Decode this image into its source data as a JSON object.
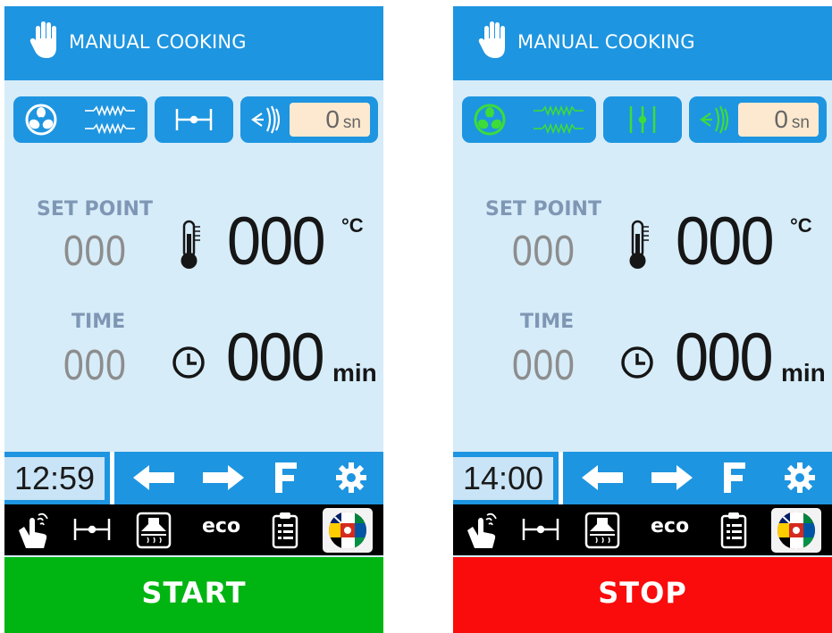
{
  "panels": [
    {
      "title": "MANUAL COOKING",
      "state": "idle",
      "accent_color": "#ffffff",
      "steam_value": "0",
      "steam_unit": "sn",
      "set_point_label": "SET POINT",
      "set_point_value": "000",
      "temperature_value": "000",
      "temperature_unit": "°C",
      "time_label": "TIME",
      "time_value": "000",
      "time_actual_value": "000",
      "time_unit": "min",
      "clock": "12:59",
      "eco_label": "eco",
      "action_label": "START",
      "action_color": "#00b512"
    },
    {
      "title": "MANUAL COOKING",
      "state": "running",
      "accent_color": "#3ddc3a",
      "steam_value": "0",
      "steam_unit": "sn",
      "set_point_label": "SET POINT",
      "set_point_value": "000",
      "temperature_value": "000",
      "temperature_unit": "°C",
      "time_label": "TIME",
      "time_value": "000",
      "time_actual_value": "000",
      "time_unit": "min",
      "clock": "14:00",
      "eco_label": "eco",
      "action_label": "STOP",
      "action_color": "#fa0c0c"
    }
  ],
  "icons": [
    "hand-icon",
    "fan-icon",
    "heater-icon",
    "damper-icon",
    "steam-icon",
    "thermometer-icon",
    "clock-icon",
    "arrow-left-icon",
    "arrow-right-icon",
    "f-icon",
    "gear-icon",
    "touch-icon",
    "hood-icon",
    "checklist-icon",
    "flags-globe-icon"
  ],
  "colors": {
    "header_blue": "#1e95e0",
    "panel_bg": "#d6ecf9",
    "label_blue_gray": "#7f97b4"
  }
}
